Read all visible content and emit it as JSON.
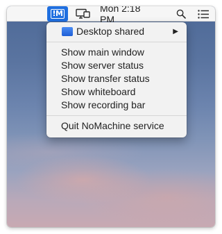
{
  "menubar": {
    "clock": "Mon 2:18 PM",
    "icons": {
      "nomachine_status": "nomachine-status-icon",
      "display": "display-icon",
      "search": "search-icon",
      "control_center": "list-icon"
    },
    "nomachine_logo_text": "!M",
    "accent": "#1f6fe0"
  },
  "menu": {
    "desktop_shared": {
      "label": "Desktop shared",
      "icon": "desktop-icon",
      "submenu_indicator": "▶"
    },
    "items": [
      {
        "label": "Show main window"
      },
      {
        "label": "Show server status"
      },
      {
        "label": "Show transfer status"
      },
      {
        "label": "Show whiteboard"
      },
      {
        "label": "Show recording bar"
      }
    ],
    "quit": {
      "label": "Quit NoMachine service"
    }
  }
}
